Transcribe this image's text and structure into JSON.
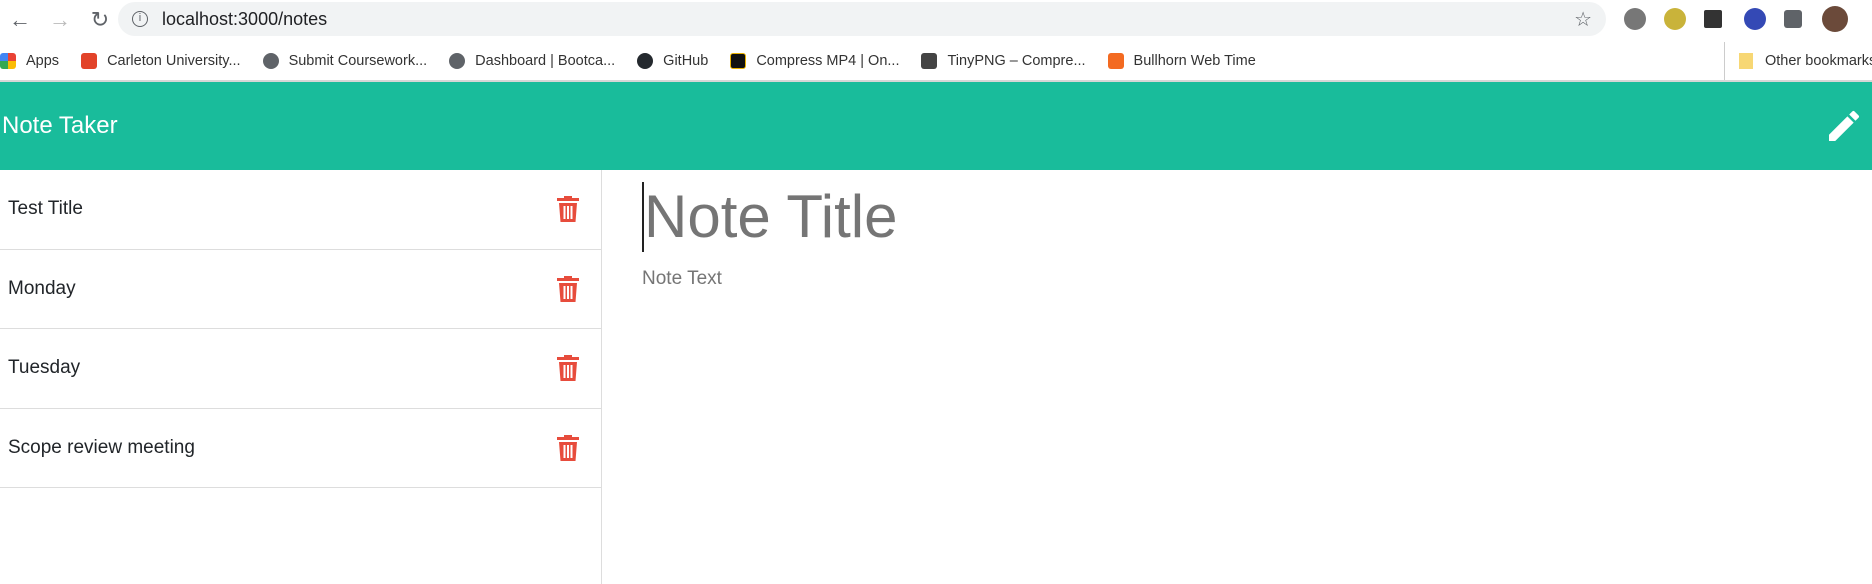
{
  "browser": {
    "url": "localhost:3000/notes",
    "bookmarks": [
      {
        "label": "Apps",
        "color": "#e94235"
      },
      {
        "label": "Carleton University...",
        "color": "#e24329"
      },
      {
        "label": "Submit Coursework...",
        "color": "#5f6368"
      },
      {
        "label": "Dashboard | Bootca...",
        "color": "#5f6368"
      },
      {
        "label": "GitHub",
        "color": "#24292e"
      },
      {
        "label": "Compress MP4 | On...",
        "color": "#111"
      },
      {
        "label": "TinyPNG – Compre...",
        "color": "#444"
      },
      {
        "label": "Bullhorn Web Time",
        "color": "#f36a21"
      }
    ],
    "other_bookmarks": "Other bookmarks"
  },
  "app": {
    "title": "Note Taker",
    "accent": "#19bc9b",
    "delete_color": "#e74c3c"
  },
  "notes": [
    {
      "title": "Test Title"
    },
    {
      "title": "Monday"
    },
    {
      "title": "Tuesday"
    },
    {
      "title": "Scope review meeting"
    }
  ],
  "editor": {
    "title_placeholder": "Note Title",
    "text_placeholder": "Note Text"
  }
}
